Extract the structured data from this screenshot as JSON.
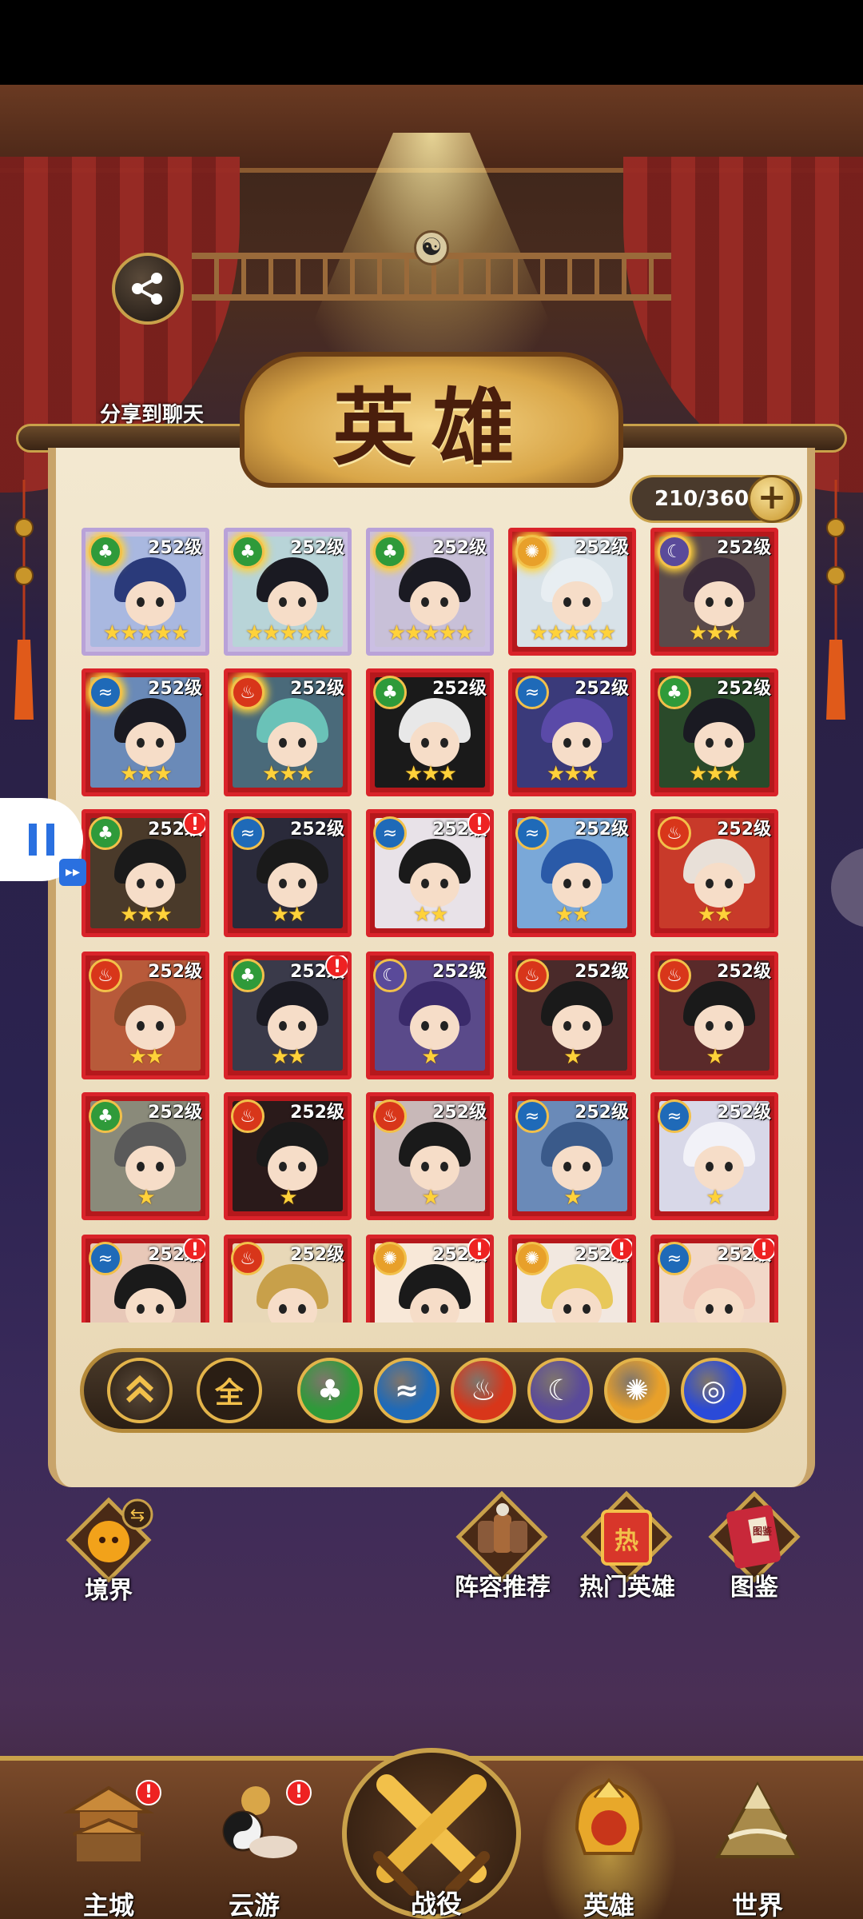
{
  "share": {
    "label": "分享到聊天",
    "icon": "share-icon"
  },
  "title": "英雄",
  "hero_count": "210/360",
  "heroes": [
    {
      "level": "252级",
      "element": "wood",
      "stars": "★★★★★",
      "frame": "purple",
      "alert": false,
      "awakened": true,
      "hair": "#2a3a7a",
      "bg": "#a9b8e0"
    },
    {
      "level": "252级",
      "element": "wood",
      "stars": "★★★★★",
      "frame": "purple",
      "alert": false,
      "awakened": true,
      "hair": "#1a1a22",
      "bg": "#b8d4d8"
    },
    {
      "level": "252级",
      "element": "wood",
      "stars": "★★★★★",
      "frame": "purple",
      "alert": false,
      "awakened": true,
      "hair": "#1a1a22",
      "bg": "#c8c0d8"
    },
    {
      "level": "252级",
      "element": "light",
      "stars": "★★★★★",
      "frame": "red",
      "alert": false,
      "awakened": true,
      "hair": "#e8eef2",
      "bg": "#d8e2e8"
    },
    {
      "level": "252级",
      "element": "moon",
      "stars": "★★★",
      "frame": "red",
      "alert": false,
      "awakened": true,
      "hair": "#3a2a3a",
      "bg": "#5a4a4a"
    },
    {
      "level": "252级",
      "element": "water",
      "stars": "★★★",
      "frame": "red",
      "alert": false,
      "awakened": true,
      "hair": "#1a1a22",
      "bg": "#6a8ab8"
    },
    {
      "level": "252级",
      "element": "fire",
      "stars": "★★★",
      "frame": "red",
      "alert": false,
      "awakened": true,
      "hair": "#6ac2b8",
      "bg": "#4a6a7a"
    },
    {
      "level": "252级",
      "element": "wood",
      "stars": "★★★",
      "frame": "red",
      "alert": false,
      "awakened": false,
      "hair": "#e8e8e8",
      "bg": "#1a1a1a"
    },
    {
      "level": "252级",
      "element": "water",
      "stars": "★★★",
      "frame": "red",
      "alert": false,
      "awakened": false,
      "hair": "#5a4aa8",
      "bg": "#3a3a7a"
    },
    {
      "level": "252级",
      "element": "wood",
      "stars": "★★★",
      "frame": "red",
      "alert": false,
      "awakened": false,
      "hair": "#1a1a22",
      "bg": "#2a4a2a"
    },
    {
      "level": "252级",
      "element": "wood",
      "stars": "★★★",
      "frame": "red",
      "alert": true,
      "awakened": false,
      "hair": "#1a1a1a",
      "bg": "#4a3a2a"
    },
    {
      "level": "252级",
      "element": "water",
      "stars": "★★",
      "frame": "red",
      "alert": false,
      "awakened": false,
      "hair": "#1a1a1a",
      "bg": "#2a2a3a"
    },
    {
      "level": "252级",
      "element": "water",
      "stars": "★★",
      "frame": "red",
      "alert": true,
      "awakened": false,
      "hair": "#1a1a1a",
      "bg": "#e8e2e8"
    },
    {
      "level": "252级",
      "element": "water",
      "stars": "★★",
      "frame": "red",
      "alert": false,
      "awakened": false,
      "hair": "#2a5aa8",
      "bg": "#7aa8d8"
    },
    {
      "level": "252级",
      "element": "fire",
      "stars": "★★",
      "frame": "red",
      "alert": false,
      "awakened": false,
      "hair": "#e8e0d8",
      "bg": "#c83a2a"
    },
    {
      "level": "252级",
      "element": "fire",
      "stars": "★★",
      "frame": "red",
      "alert": false,
      "awakened": false,
      "hair": "#8a4a2a",
      "bg": "#b85a3a"
    },
    {
      "level": "252级",
      "element": "wood",
      "stars": "★★",
      "frame": "red",
      "alert": true,
      "awakened": false,
      "hair": "#1a1a22",
      "bg": "#3a3a4a"
    },
    {
      "level": "252级",
      "element": "moon",
      "stars": "★",
      "frame": "red",
      "alert": false,
      "awakened": false,
      "hair": "#3a2a6a",
      "bg": "#5a4a8a"
    },
    {
      "level": "252级",
      "element": "fire",
      "stars": "★",
      "frame": "red",
      "alert": false,
      "awakened": false,
      "hair": "#1a1a1a",
      "bg": "#4a2a2a"
    },
    {
      "level": "252级",
      "element": "fire",
      "stars": "★",
      "frame": "red",
      "alert": false,
      "awakened": false,
      "hair": "#1a1a1a",
      "bg": "#5a2a2a"
    },
    {
      "level": "252级",
      "element": "wood",
      "stars": "★",
      "frame": "red",
      "alert": false,
      "awakened": false,
      "hair": "#5a5a5a",
      "bg": "#8a8a7a"
    },
    {
      "level": "252级",
      "element": "fire",
      "stars": "★",
      "frame": "red",
      "alert": false,
      "awakened": false,
      "hair": "#1a1a1a",
      "bg": "#2a1a1a"
    },
    {
      "level": "252级",
      "element": "fire",
      "stars": "★",
      "frame": "red",
      "alert": false,
      "awakened": false,
      "hair": "#1a1a1a",
      "bg": "#c8b8b8"
    },
    {
      "level": "252级",
      "element": "water",
      "stars": "★",
      "frame": "red",
      "alert": false,
      "awakened": false,
      "hair": "#3a5a8a",
      "bg": "#6a8ab8"
    },
    {
      "level": "252级",
      "element": "water",
      "stars": "★",
      "frame": "red",
      "alert": false,
      "awakened": false,
      "hair": "#f2f2f8",
      "bg": "#d8d8e8"
    },
    {
      "level": "252级",
      "element": "water",
      "stars": "",
      "frame": "red",
      "alert": true,
      "awakened": false,
      "hair": "#1a1a1a",
      "bg": "#e8c8b8"
    },
    {
      "level": "252级",
      "element": "fire",
      "stars": "",
      "frame": "red",
      "alert": false,
      "awakened": false,
      "hair": "#c8a04a",
      "bg": "#e8d8b8"
    },
    {
      "level": "252级",
      "element": "light",
      "stars": "",
      "frame": "red",
      "alert": true,
      "awakened": false,
      "hair": "#1a1a1a",
      "bg": "#f8e8d8"
    },
    {
      "level": "252级",
      "element": "light",
      "stars": "",
      "frame": "red",
      "alert": true,
      "awakened": false,
      "hair": "#e8c85a",
      "bg": "#f2e8e0"
    },
    {
      "level": "252级",
      "element": "water",
      "stars": "",
      "frame": "red",
      "alert": true,
      "awakened": false,
      "hair": "#f2c8b8",
      "bg": "#f2d8c8"
    }
  ],
  "element_colors": {
    "wood": "#2f9a3a",
    "water": "#1f6ab8",
    "fire": "#d8361a",
    "moon": "#5a4a9a",
    "light": "#e8a02a",
    "dark": "#2a4ad8"
  },
  "element_glyphs": {
    "wood": "♣",
    "water": "≈",
    "fire": "♨",
    "moon": "☾",
    "light": "✺",
    "dark": "◎"
  },
  "filters": {
    "collapse_icon": "chevron-up-icon",
    "all_label": "全",
    "elements": [
      "wood",
      "water",
      "fire",
      "moon",
      "light",
      "dark"
    ]
  },
  "side_buttons": {
    "realm": "境界",
    "lineup": "阵容推荐",
    "hot_heroes": "热门英雄",
    "hot_heroes_badge": "热",
    "codex": "图鉴",
    "codex_badge": "图鉴"
  },
  "nav": {
    "main_city": "主城",
    "travel": "云游",
    "battle": "战役",
    "heroes": "英雄",
    "world": "世界",
    "badge": "!"
  },
  "title_decoration": "☯"
}
